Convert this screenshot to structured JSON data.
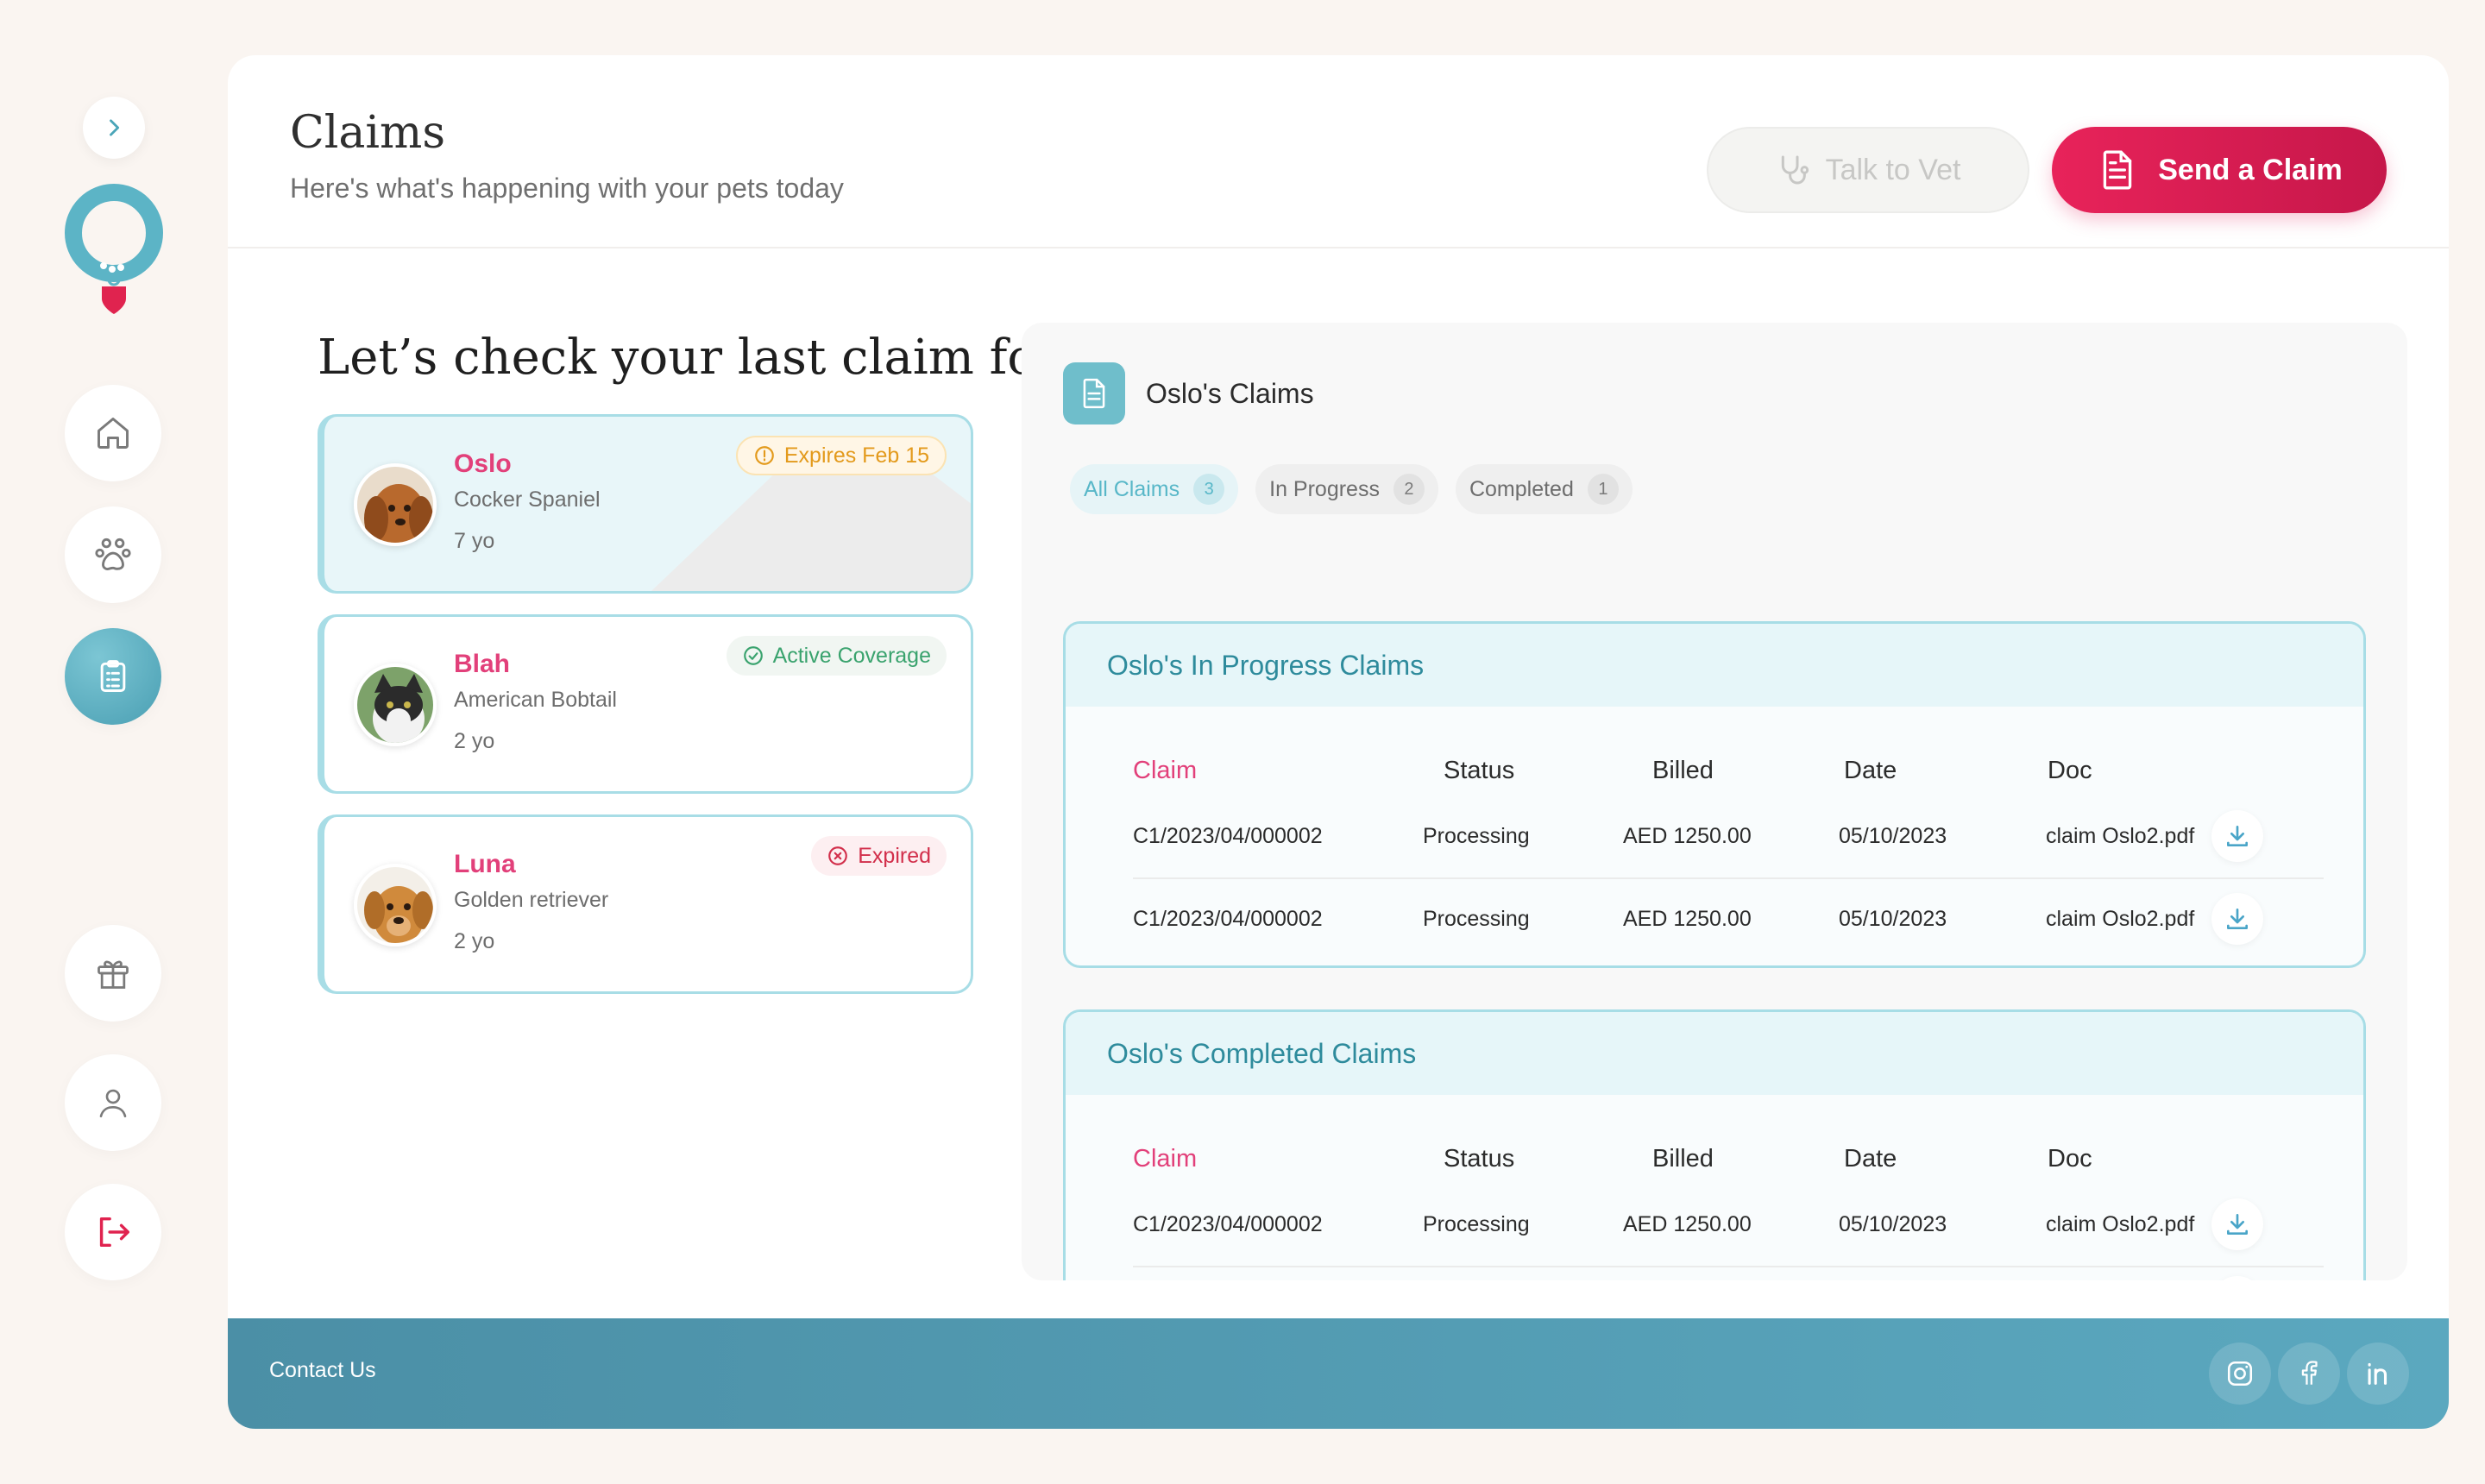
{
  "header": {
    "title": "Claims",
    "subtitle": "Here's what's happening with your pets today",
    "talk_to_vet_label": "Talk to Vet",
    "send_claim_label": "Send a Claim"
  },
  "sidebar": {
    "items": [
      {
        "icon": "home-icon"
      },
      {
        "icon": "paw-icon"
      },
      {
        "icon": "clipboard-icon",
        "active": true
      },
      {
        "icon": "gift-icon"
      },
      {
        "icon": "user-icon"
      },
      {
        "icon": "logout-icon"
      }
    ]
  },
  "section": {
    "heading": "Let’s check your last claim for :"
  },
  "pets": [
    {
      "name": "Oslo",
      "breed": "Cocker Spaniel",
      "age": "7 yo",
      "badge": "Expires Feb 15",
      "badge_type": "warning"
    },
    {
      "name": "Blah",
      "breed": "American Bobtail",
      "age": "2 yo",
      "badge": "Active Coverage",
      "badge_type": "success"
    },
    {
      "name": "Luna",
      "breed": "Golden retriever",
      "age": "2 yo",
      "badge": "Expired",
      "badge_type": "error"
    }
  ],
  "claims": {
    "title": "Oslo's Claims",
    "tabs": [
      {
        "label": "All Claims",
        "count": "3"
      },
      {
        "label": "In Progress",
        "count": "2"
      },
      {
        "label": "Completed",
        "count": "1"
      }
    ],
    "columns": [
      "Claim",
      "Status",
      "Billed",
      "Date",
      "Doc"
    ],
    "in_progress": {
      "title": "Oslo's In Progress Claims",
      "rows": [
        {
          "claim": "C1/2023/04/000002",
          "status": "Processing",
          "billed": "AED 1250.00",
          "date": "05/10/2023",
          "doc": "claim Oslo2.pdf"
        },
        {
          "claim": "C1/2023/04/000002",
          "status": "Processing",
          "billed": "AED 1250.00",
          "date": "05/10/2023",
          "doc": "claim Oslo2.pdf"
        }
      ]
    },
    "completed": {
      "title": "Oslo's Completed Claims",
      "rows": [
        {
          "claim": "C1/2023/04/000002",
          "status": "Processing",
          "billed": "AED 1250.00",
          "date": "05/10/2023",
          "doc": "claim Oslo2.pdf"
        }
      ]
    }
  },
  "footer": {
    "contact_label": "Contact Us",
    "social": [
      "instagram-icon",
      "facebook-icon",
      "linkedin-icon"
    ]
  },
  "colors": {
    "accent": "#e2407a",
    "primary_button": "#e8235a",
    "teal": "#4a9fb3",
    "warning": "#e39a1c",
    "success": "#3aa36e",
    "error": "#d22f4b"
  }
}
